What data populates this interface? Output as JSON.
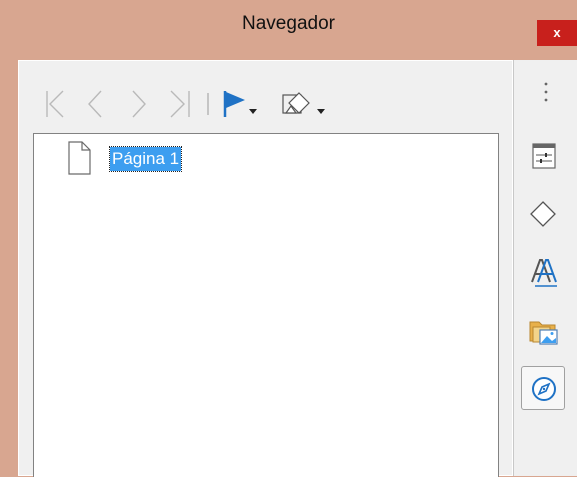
{
  "window": {
    "title": "Navegador",
    "close_label": "x"
  },
  "toolbar": {
    "buttons": [
      {
        "name": "first-page",
        "icon": "skip-to-start-icon",
        "enabled": false
      },
      {
        "name": "previous-page",
        "icon": "chevron-left-icon",
        "enabled": false
      },
      {
        "name": "next-page",
        "icon": "chevron-right-icon",
        "enabled": false
      },
      {
        "name": "last-page",
        "icon": "skip-to-end-icon",
        "enabled": false
      },
      {
        "name": "drag-mode",
        "icon": "flag-icon",
        "enabled": true,
        "dropdown": true
      },
      {
        "name": "shapes",
        "icon": "shapes-icon",
        "enabled": true,
        "dropdown": true
      }
    ]
  },
  "tree": {
    "items": [
      {
        "label": "Página 1",
        "icon": "page-icon",
        "selected": true
      }
    ]
  },
  "sidebar": {
    "menu_icon": "more-options-icon",
    "deck_buttons": [
      {
        "name": "properties",
        "icon": "properties-sliders-icon",
        "active": false
      },
      {
        "name": "shapes",
        "icon": "diamond-shape-icon",
        "active": false
      },
      {
        "name": "styles",
        "icon": "styles-aa-icon",
        "active": false
      },
      {
        "name": "gallery",
        "icon": "gallery-image-folder-icon",
        "active": false
      },
      {
        "name": "navigator",
        "icon": "compass-icon",
        "active": true
      }
    ]
  },
  "colors": {
    "titlebar": "#d8a690",
    "close": "#c8201c",
    "selection": "#3d9ef0",
    "flag": "#1f72c5",
    "disabled_icon": "#b9b9b9"
  }
}
